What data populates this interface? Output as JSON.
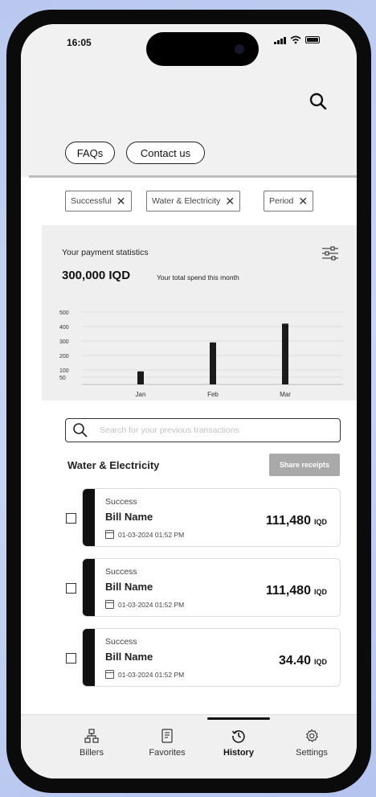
{
  "status_bar": {
    "time": "16:05"
  },
  "top_links": {
    "faqs": "FAQs",
    "contact": "Contact us"
  },
  "filters": [
    {
      "label": "Successful"
    },
    {
      "label": "Water & Electricity"
    },
    {
      "label": "Period"
    }
  ],
  "stats": {
    "label": "Your payment statistics",
    "amount": "300,000 IQD",
    "sub": "Your total spend this month"
  },
  "chart_data": {
    "type": "bar",
    "categories": [
      "Jan",
      "Feb",
      "Mar"
    ],
    "values": [
      90,
      290,
      420
    ],
    "yticks": [
      500,
      400,
      300,
      200,
      100,
      50
    ],
    "ylim": [
      0,
      500
    ],
    "title": "",
    "xlabel": "",
    "ylabel": ""
  },
  "search": {
    "placeholder": "Search for your previous transactions"
  },
  "section": {
    "title": "Water & Electricity",
    "share_label": "Share receipts"
  },
  "transactions": [
    {
      "status": "Success",
      "name": "Bill Name",
      "date": "01-03-2024 01:52 PM",
      "amount": "111,480",
      "currency": "IQD"
    },
    {
      "status": "Success",
      "name": "Bill Name",
      "date": "01-03-2024 01:52 PM",
      "amount": "111,480",
      "currency": "IQD"
    },
    {
      "status": "Success",
      "name": "Bill Name",
      "date": "01-03-2024 01:52 PM",
      "amount": "34.40",
      "currency": "IQD"
    }
  ],
  "tabs": [
    {
      "label": "Billers",
      "icon": "billers-icon"
    },
    {
      "label": "Favorites",
      "icon": "favorites-icon"
    },
    {
      "label": "History",
      "icon": "history-icon",
      "active": true
    },
    {
      "label": "Settings",
      "icon": "settings-icon"
    }
  ],
  "colors": {
    "accent": "#111111",
    "share_button": "#a9a9a9",
    "panel": "#efefef"
  }
}
